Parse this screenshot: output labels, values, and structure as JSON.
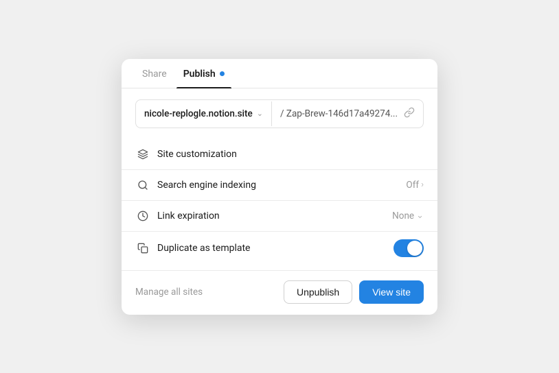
{
  "tabs": [
    {
      "id": "share",
      "label": "Share",
      "active": false
    },
    {
      "id": "publish",
      "label": "Publish",
      "active": true,
      "dot": true
    }
  ],
  "urlBar": {
    "domain": "nicole-replogle.notion.site",
    "slug": "/ Zap-Brew-146d17a49274...",
    "chevron": "›",
    "linkIcon": "🔗"
  },
  "settings": [
    {
      "id": "site-customization",
      "icon": "✏️",
      "label": "Site customization",
      "value": "",
      "valueType": "none"
    },
    {
      "id": "search-engine-indexing",
      "icon": "🔍",
      "label": "Search engine indexing",
      "value": "Off",
      "valueType": "chevron-right"
    },
    {
      "id": "link-expiration",
      "icon": "⏱",
      "label": "Link expiration",
      "value": "None",
      "valueType": "chevron-down"
    },
    {
      "id": "duplicate-as-template",
      "icon": "📋",
      "label": "Duplicate as template",
      "value": "",
      "valueType": "toggle",
      "toggleOn": true
    }
  ],
  "footer": {
    "manageLink": "Manage all sites",
    "unpublishLabel": "Unpublish",
    "viewSiteLabel": "View site"
  }
}
